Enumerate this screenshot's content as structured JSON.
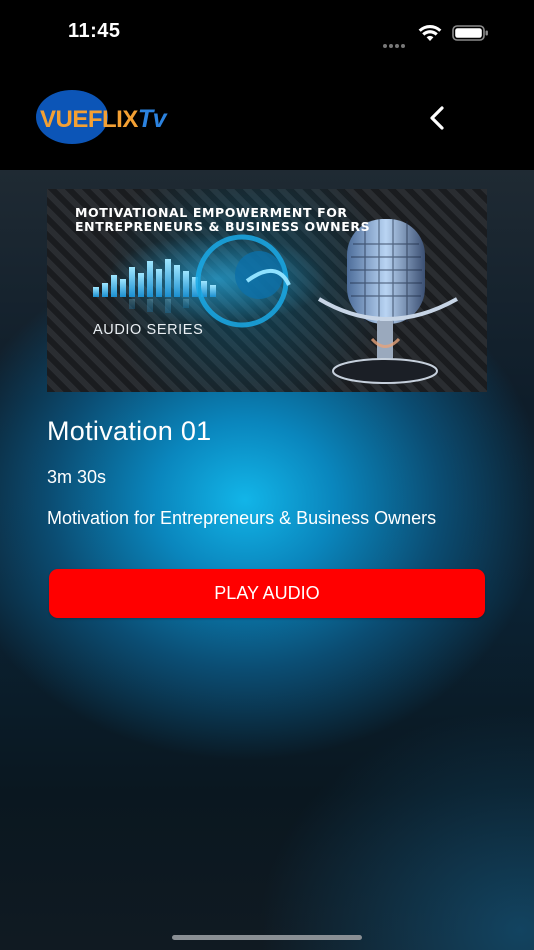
{
  "status_bar": {
    "time": "11:45",
    "icons": [
      "cellular-dots-icon",
      "wifi-icon",
      "battery-icon"
    ]
  },
  "header": {
    "logo": {
      "vue": "VUE",
      "flix": "FLIX",
      "tv": "Tv"
    },
    "back_icon": "chevron-left-icon"
  },
  "thumbnail": {
    "title": "MOTIVATIONAL EMPOWERMENT FOR ENTREPRENEURS & BUSINESS OWNERS",
    "subtitle": "AUDIO SERIES"
  },
  "audio": {
    "title": "Motivation 01",
    "duration": "3m 30s",
    "description": "Motivation for Entrepreneurs & Business Owners"
  },
  "actions": {
    "play_label": "PLAY AUDIO"
  },
  "colors": {
    "accent": "#ff0000",
    "logo_orange": "#f4a033",
    "logo_blue": "#0c55b7",
    "background_glow": "#12b5e8"
  }
}
